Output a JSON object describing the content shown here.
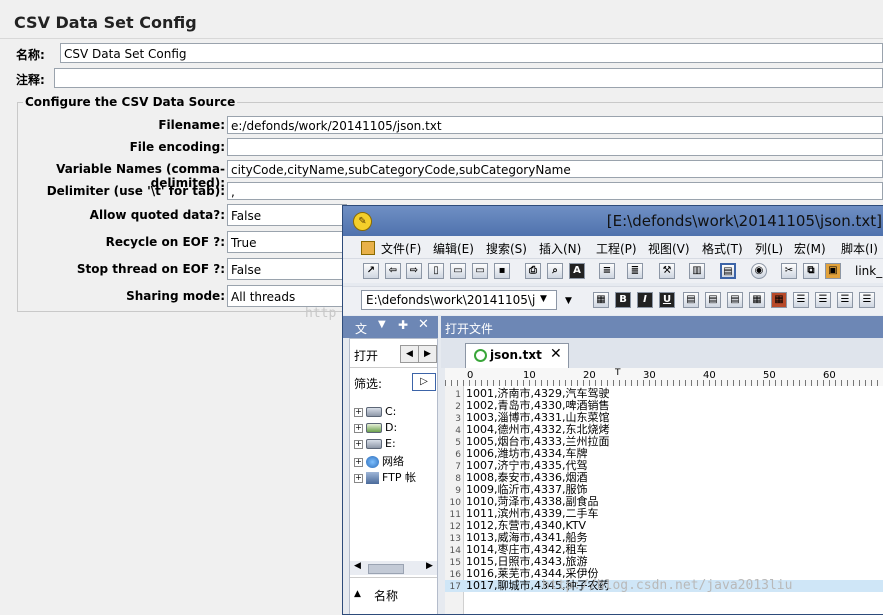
{
  "config": {
    "title": "CSV Data Set Config",
    "name_label": "名称:",
    "name_value": "CSV Data Set Config",
    "comment_label": "注释:",
    "comment_value": "",
    "group_title": "Configure the CSV Data Source",
    "fields": [
      {
        "label": "Filename:",
        "value": "e:/defonds/work/20141105/json.txt"
      },
      {
        "label": "File encoding:",
        "value": ""
      },
      {
        "label": "Variable Names (comma-delimited):",
        "value": "cityCode,cityName,subCategoryCode,subCategoryName"
      },
      {
        "label": "Delimiter (use '\\t' for tab):",
        "value": ","
      }
    ],
    "combos": [
      {
        "label": "Allow quoted data?:",
        "value": "False"
      },
      {
        "label": "Recycle on EOF ?:",
        "value": "True"
      },
      {
        "label": "Stop thread on EOF ?:",
        "value": "False"
      },
      {
        "label": "Sharing mode:",
        "value": "All threads"
      }
    ]
  },
  "notepad": {
    "title": "[E:\\defonds\\work\\20141105\\json.txt]",
    "menu": [
      "文件(F)",
      "编辑(E)",
      "搜索(S)",
      "插入(N)",
      "工程(P)",
      "视图(V)",
      "格式(T)",
      "列(L)",
      "宏(M)",
      "脚本(I)"
    ],
    "toolbar_tail_text": "link_",
    "path_combo": "E:\\defonds\\work\\20141105\\j",
    "side_header": "文",
    "open_button": "打开",
    "filter_label": "筛选:",
    "tree": [
      {
        "label": "C:",
        "icon": "drive-icon"
      },
      {
        "label": "D:",
        "icon": "dvd-drive-icon"
      },
      {
        "label": "E:",
        "icon": "drive-icon"
      },
      {
        "label": "网络",
        "icon": "network-icon"
      },
      {
        "label": "FTP 帐",
        "icon": "ftp-icon"
      }
    ],
    "name_column": "名称",
    "edit_header": "打开文件",
    "tab_label": "json.txt",
    "ruler_marks": [
      "0",
      "10",
      "20",
      "30",
      "40",
      "50",
      "60",
      "7"
    ],
    "lines": [
      "1001,济南市,4329,汽车驾驶",
      "1002,青岛市,4330,啤酒销售",
      "1003,淄博市,4331,山东菜馆",
      "1004,德州市,4332,东北烧烤",
      "1005,烟台市,4333,兰州拉面",
      "1006,潍坊市,4334,车牌",
      "1007,济宁市,4335,代驾",
      "1008,泰安市,4336,烟酒",
      "1009,临沂市,4337,服饰",
      "1010,菏泽市,4338,副食品",
      "1011,滨州市,4339,二手车",
      "1012,东营市,4340,KTV",
      "1013,威海市,4341,船务",
      "1014,枣庄市,4342,租车",
      "1015,日照市,4343,旅游",
      "1016,莱芜市,4344,采伊份",
      "1017,聊城市,4345,种子农药"
    ],
    "highlighted_line": 17
  },
  "watermarks": {
    "left": "http",
    "bottom": "http://blog.csdn.net/java2013liu"
  },
  "colors": {
    "titlebar": "#4f72ad",
    "panel_header": "#6d87b5",
    "selection": "#cfe6f7"
  }
}
